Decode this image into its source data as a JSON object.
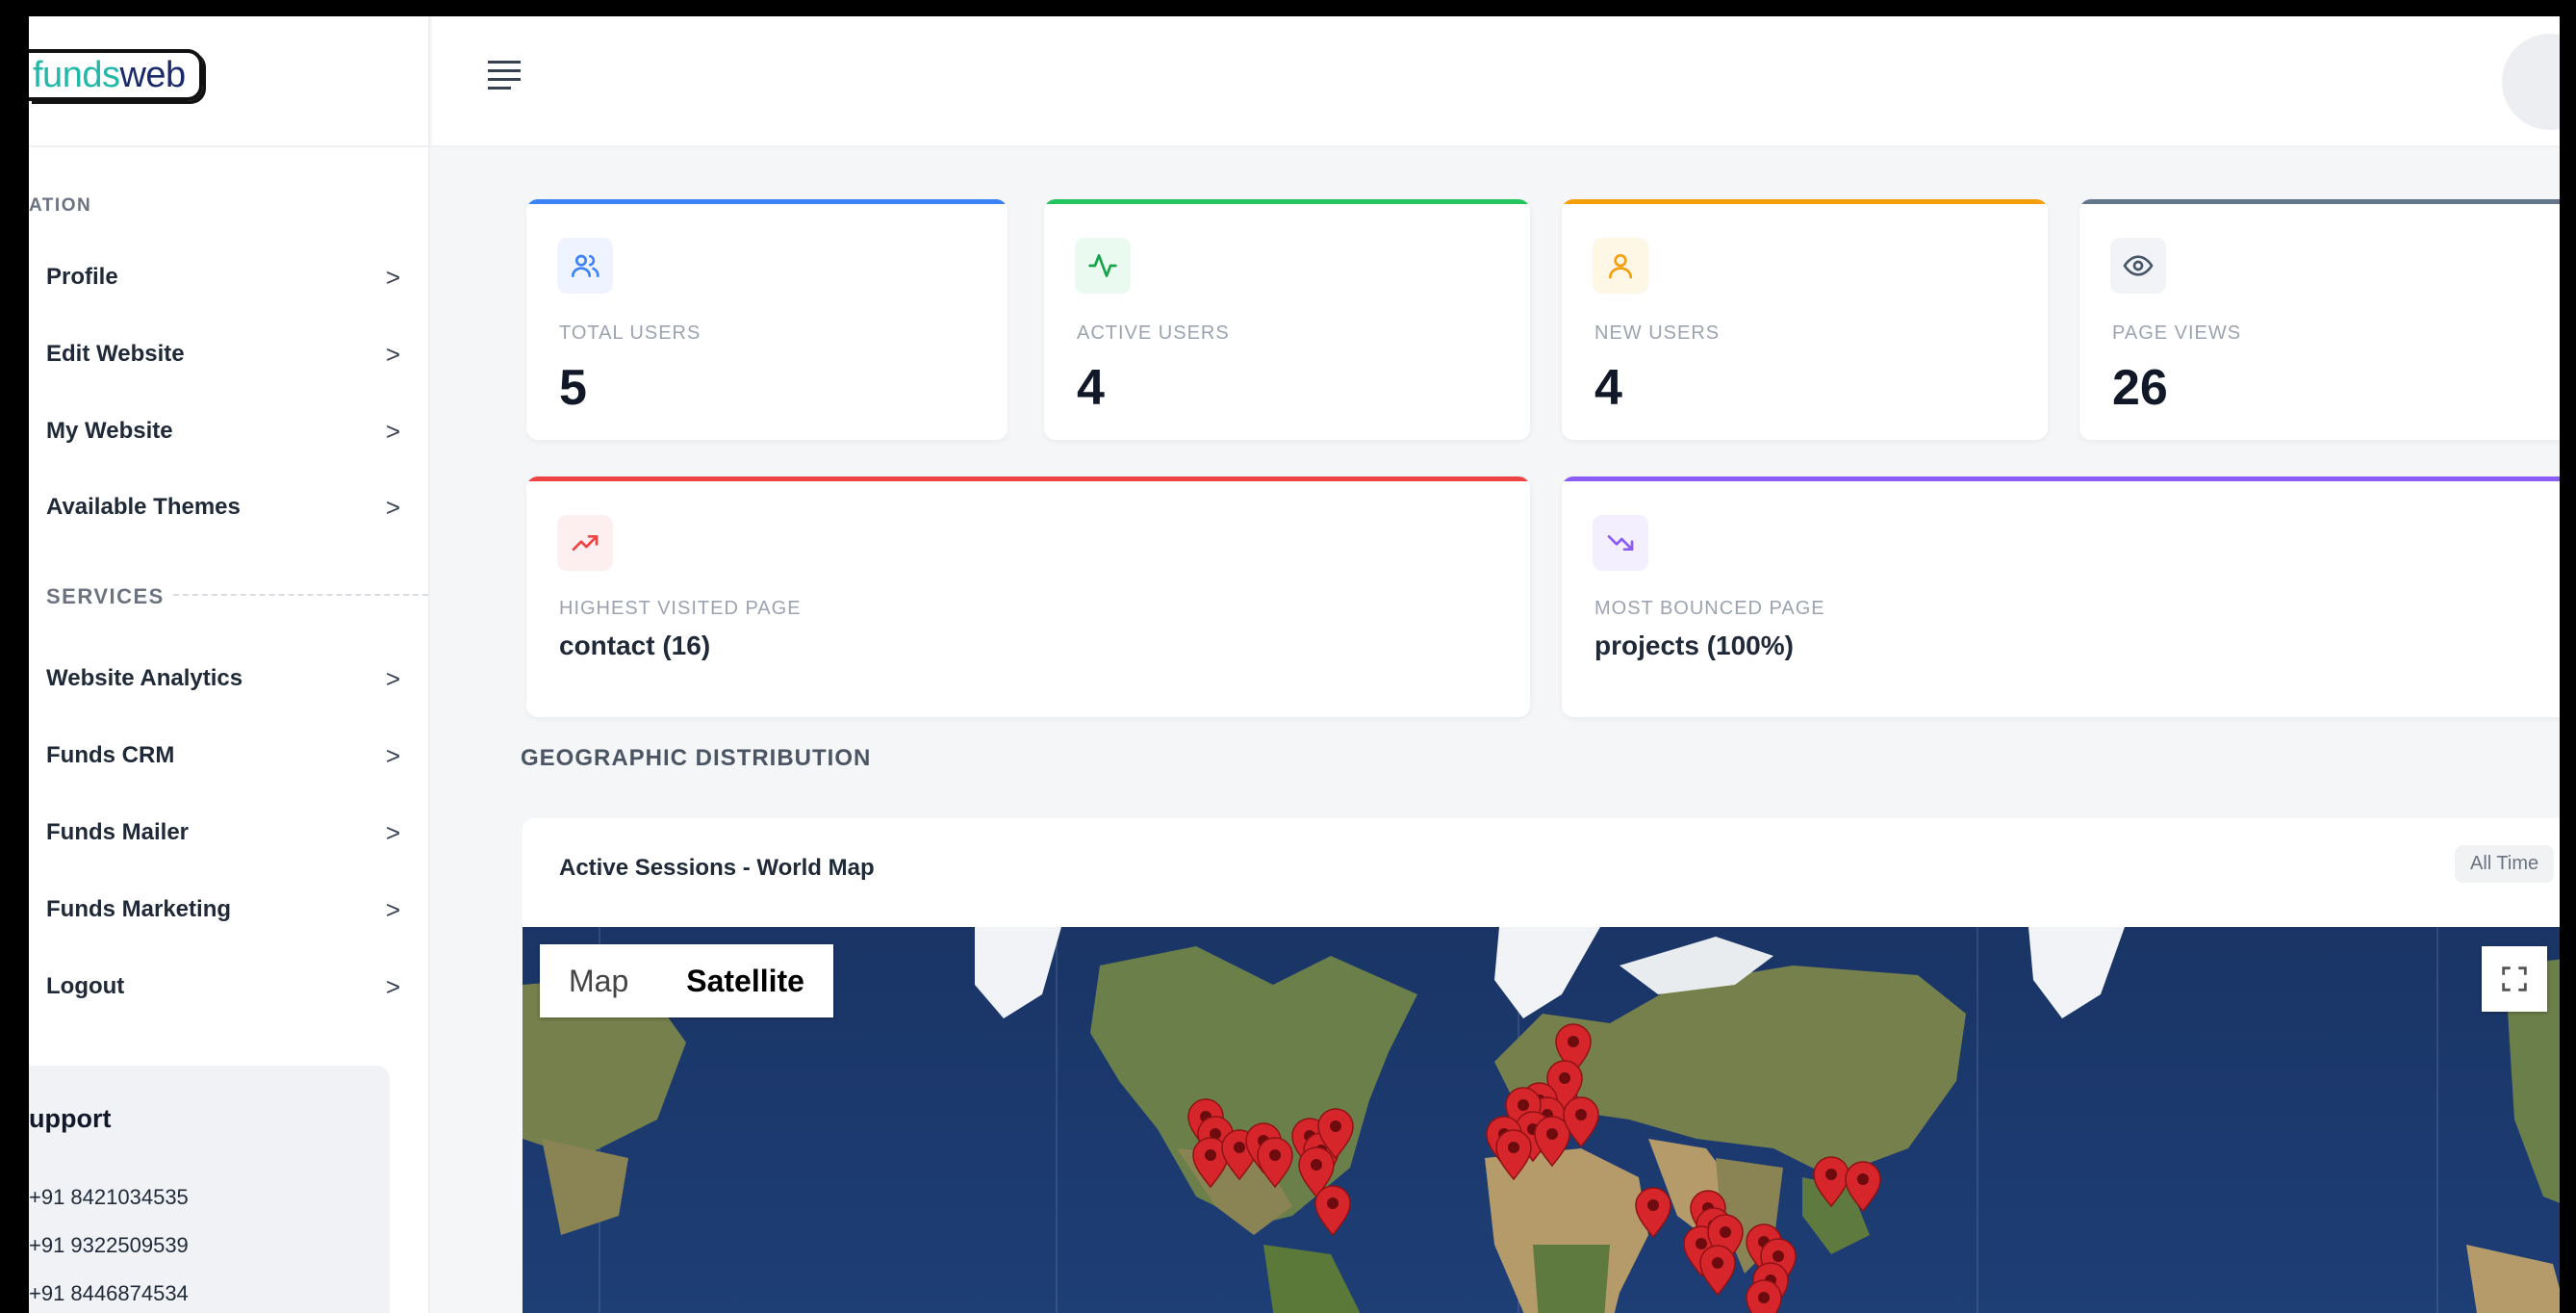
{
  "brand": {
    "logo_part1": "funds",
    "logo_part2": "web"
  },
  "sidebar": {
    "section1_label": "ATION",
    "section1_items": [
      {
        "label": "Profile"
      },
      {
        "label": "Edit Website"
      },
      {
        "label": "My Website"
      },
      {
        "label": "Available Themes"
      }
    ],
    "section2_label": "SERVICES",
    "section2_items": [
      {
        "label": "Website Analytics"
      },
      {
        "label": "Funds CRM"
      },
      {
        "label": "Funds Mailer"
      },
      {
        "label": "Funds Marketing"
      },
      {
        "label": "Logout"
      }
    ],
    "chevron": ">",
    "support": {
      "title": "upport",
      "phones": [
        "+91 8421034535",
        "+91 9322509539",
        "+91 8446874534"
      ]
    }
  },
  "stats": [
    {
      "label": "TOTAL USERS",
      "value": "5",
      "color": "#3b82f6",
      "icon": "users-icon"
    },
    {
      "label": "ACTIVE USERS",
      "value": "4",
      "color": "#22c55e",
      "icon": "activity-icon"
    },
    {
      "label": "NEW USERS",
      "value": "4",
      "color": "#f59e0b",
      "icon": "user-icon"
    },
    {
      "label": "PAGE VIEWS",
      "value": "26",
      "color": "#64748b",
      "icon": "eye-icon"
    }
  ],
  "highlights": [
    {
      "label": "HIGHEST VISITED PAGE",
      "value": "contact (16)",
      "color": "#ef4444",
      "icon": "trending-up-icon"
    },
    {
      "label": "MOST BOUNCED PAGE",
      "value": "projects (100%)",
      "color": "#8b5cf6",
      "icon": "trending-down-icon"
    }
  ],
  "geo": {
    "section_title": "GEOGRAPHIC DISTRIBUTION",
    "card_title": "Active Sessions - World Map",
    "range": "All Time",
    "map_label": "Map",
    "satellite_label": "Satellite"
  }
}
